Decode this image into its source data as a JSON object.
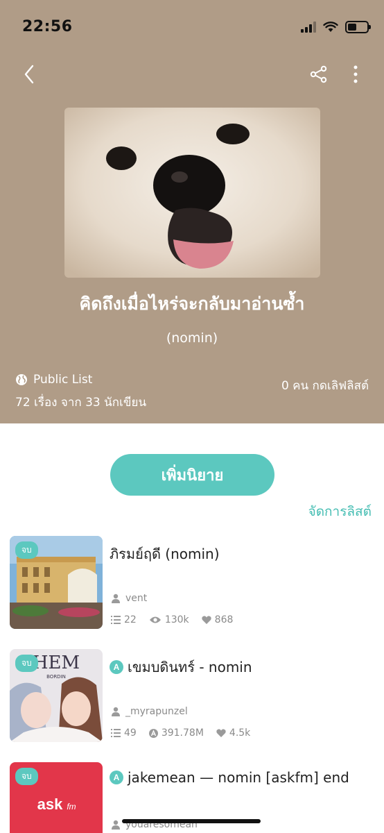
{
  "status_bar": {
    "time": "22:56"
  },
  "header": {
    "title": "คิดถึงเมื่อไหร่จะกลับมาอ่านซ้ำ",
    "subtitle": "(nomin)",
    "visibility_label": "Public List",
    "story_count": "72 เรื่อง จาก 33 นักเขียน",
    "followers": "0 คน กดเลิฟลิสต์",
    "icons": {
      "back": "chevron-left-icon",
      "share": "share-icon",
      "more": "more-vertical-icon",
      "globe": "globe-icon"
    }
  },
  "actions": {
    "add_label": "เพิ่มนิยาย",
    "manage_label": "จัดการลิสต์"
  },
  "stories": [
    {
      "badge": "จบ",
      "title": "ภิรมย์ฤดี (nomin)",
      "app_badge": "",
      "author": "vent",
      "chapters": "22",
      "views": "130k",
      "likes": "868"
    },
    {
      "badge": "จบ",
      "title": "เขมบดินทร์ - nomin",
      "app_badge": "A",
      "author": "_myrapunzel",
      "chapters": "49",
      "views": "391.78M",
      "likes": "4.5k",
      "cover_text": "HEM",
      "cover_subtext": "BORDIN"
    },
    {
      "badge": "จบ",
      "title": "jakemean — nomin [askfm] end",
      "app_badge": "A",
      "author": "youaresomean",
      "cover_text": "ask",
      "cover_subtext": "fm"
    }
  ],
  "colors": {
    "hero": "#b09c87",
    "accent": "#5cc8bf",
    "text_muted": "#8a8a8a"
  }
}
